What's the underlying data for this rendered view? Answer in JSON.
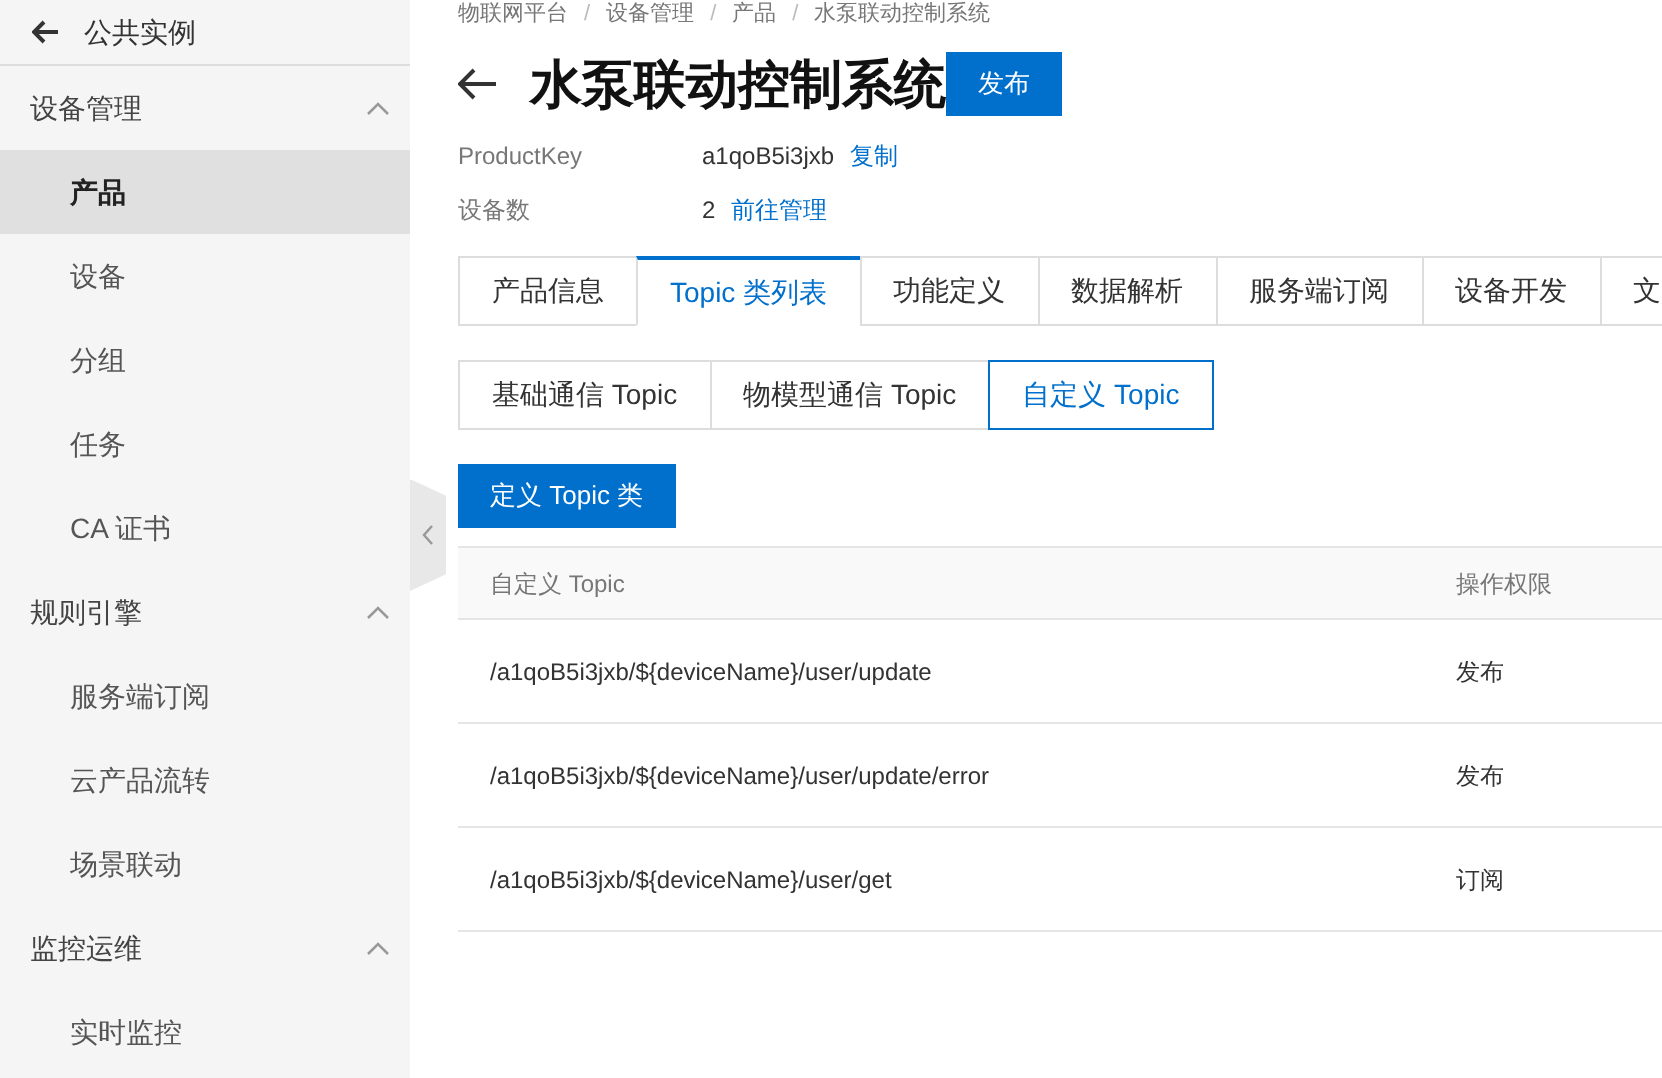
{
  "sidebar": {
    "back_label": "公共实例",
    "groups": [
      {
        "label": "设备管理",
        "expanded": true,
        "items": [
          {
            "label": "产品",
            "selected": true
          },
          {
            "label": "设备",
            "selected": false
          },
          {
            "label": "分组",
            "selected": false
          },
          {
            "label": "任务",
            "selected": false
          },
          {
            "label": "CA 证书",
            "selected": false
          }
        ]
      },
      {
        "label": "规则引擎",
        "expanded": true,
        "items": [
          {
            "label": "服务端订阅",
            "selected": false
          },
          {
            "label": "云产品流转",
            "selected": false
          },
          {
            "label": "场景联动",
            "selected": false
          }
        ]
      },
      {
        "label": "监控运维",
        "expanded": true,
        "items": [
          {
            "label": "实时监控",
            "selected": false
          }
        ]
      }
    ]
  },
  "breadcrumb": {
    "separator": "/",
    "items": [
      "物联网平台",
      "设备管理",
      "产品",
      "水泵联动控制系统"
    ]
  },
  "title": "水泵联动控制系统",
  "status_button": "发布",
  "info": [
    {
      "label": "ProductKey",
      "value": "a1qoB5i3jxb",
      "action": "复制"
    },
    {
      "label": "设备数",
      "value": "2",
      "action": "前往管理"
    }
  ],
  "tabs": [
    {
      "label": "产品信息",
      "selected": false
    },
    {
      "label": "Topic 类列表",
      "selected": true
    },
    {
      "label": "功能定义",
      "selected": false
    },
    {
      "label": "数据解析",
      "selected": false
    },
    {
      "label": "服务端订阅",
      "selected": false
    },
    {
      "label": "设备开发",
      "selected": false
    },
    {
      "label": "文",
      "selected": false
    }
  ],
  "sub_tabs": [
    {
      "label": "基础通信 Topic",
      "selected": false
    },
    {
      "label": "物模型通信 Topic",
      "selected": false
    },
    {
      "label": "自定义 Topic",
      "selected": true
    }
  ],
  "define_button": "定义 Topic 类",
  "table": {
    "columns": [
      "自定义 Topic",
      "操作权限"
    ],
    "rows": [
      [
        "/a1qoB5i3jxb/${deviceName}/user/update",
        "发布"
      ],
      [
        "/a1qoB5i3jxb/${deviceName}/user/update/error",
        "发布"
      ],
      [
        "/a1qoB5i3jxb/${deviceName}/user/get",
        "订阅"
      ]
    ]
  }
}
